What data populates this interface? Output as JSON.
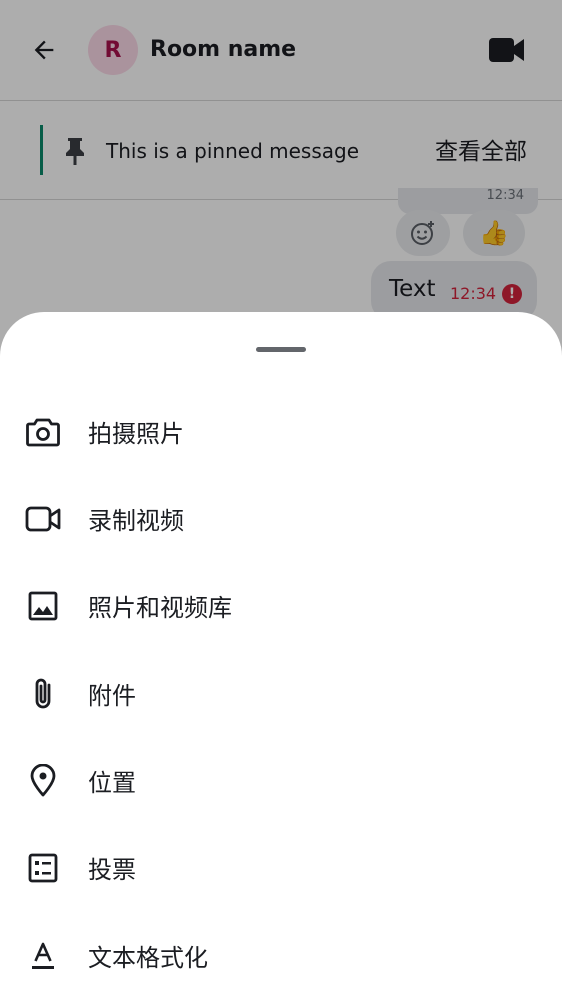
{
  "header": {
    "avatar_initial": "R",
    "room_name": "Room name"
  },
  "pinned": {
    "message": "This is a pinned message",
    "view_all": "查看全部"
  },
  "timeline": {
    "previous_time": "12:34",
    "reaction_emoji": "👍",
    "message_text": "Text",
    "message_time": "12:34",
    "error_mark": "!"
  },
  "sheet": {
    "items": [
      {
        "label": "拍摄照片",
        "icon": "camera-icon"
      },
      {
        "label": "录制视频",
        "icon": "videocam-icon"
      },
      {
        "label": "照片和视频库",
        "icon": "image-icon"
      },
      {
        "label": "附件",
        "icon": "attachment-icon"
      },
      {
        "label": "位置",
        "icon": "location-icon"
      },
      {
        "label": "投票",
        "icon": "poll-icon"
      },
      {
        "label": "文本格式化",
        "icon": "text-format-icon"
      }
    ]
  },
  "colors": {
    "avatar_bg": "#fbd9e8",
    "avatar_text": "#a8114d",
    "pin_accent": "#0b8a6a",
    "error": "#d1233b"
  }
}
